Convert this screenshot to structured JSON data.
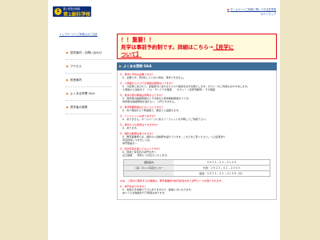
{
  "header": {
    "logo": {
      "sub": "愛と知恵の創造",
      "main": "第1歯科学校",
      "tail": "ホーム",
      "crest": "1"
    },
    "top_link": "ホームページご利用に関しての注意事項",
    "sitemap": "サイトマップ"
  },
  "breadcrumb": "トップページ＞ご利用上のご注意",
  "sidebar": {
    "items": [
      {
        "label": "見学案内・お問い合わせ"
      },
      {
        "label": "アクセス"
      },
      {
        "label": "校舎案内"
      },
      {
        "label": "よくある質問 Q&A"
      },
      {
        "label": "見学者の感想"
      }
    ]
  },
  "banner": {
    "line1": "！！重要！！",
    "line2_text": "見学は事前予約制です。詳細はこちら→",
    "line2_link": "【見学に",
    "line3_link": "ついて】"
  },
  "qa": {
    "heading": "よくある質問 Q&A",
    "items": [
      {
        "q": "Q．見学に予約は必要ですか？",
        "a": [
          "A．必要です。予約をしていない場合、見学できません。"
        ]
      },
      {
        "q": "Q．小雨後からバスでの移動は問題ないですか？",
        "a": [
          "A．今回見に来られて、建築部分に合わせたマスク着用を必ずお願いします。タクシーのご利用もおすすめします。",
          "小雨後から当校まで　バス・８～１０分程度　　タクシー（当家待機車）・８分程度"
        ]
      },
      {
        "q": "Q．見学の受付時間は何時からですか？",
        "a": [
          "A．見学案内開始時間の１５分前から見学開始時間までです。",
          "見学案内開始時間を過ぎると、入門できません。"
        ]
      },
      {
        "q": "Q．見学所要時間はどのくらいですか？",
        "a": [
          "A．約１時間から２時間程で、都合で入館願えます。"
        ]
      },
      {
        "q": "Q．パンフレットはありますか？",
        "a": [
          "A．ありません。ホームページにあるリーフレットを印刷してご利用下さい。"
        ]
      },
      {
        "q": "Q．車椅子でも見学はできますか？",
        "a": [
          "A．あります。"
        ]
      },
      {
        "q": "Q．撮影の制限はありますか？",
        "a": [
          "A．教育事業柄では、撮影の入館制限を設けています。こちらをご覧ください。へ上館見送り",
          "写真資料につきましては、",
          "専門施設の…"
        ]
      },
      {
        "q": "Q．記念写真を撮ってもいいですか？",
        "a": [
          "A．別途ご写真高の専門の方へ",
          "窓口連絡　　特別にてお伝えいたします。"
        ]
      }
    ]
  },
  "contact": {
    "rows": [
      {
        "label": "通院案内",
        "value": "０９２３－４２－５１０９"
      },
      {
        "label": "（専）ポンド写真センター",
        "value": "代表：０９２３－４２－２０６５"
      },
      {
        "label": "",
        "value": "夜間：０９２３－４２－０１９８（代）"
      }
    ]
  },
  "qa2": {
    "items": [
      {
        "q": "なお、ご案内で撮影するか開始は、教育事業所の許可担当以外で専門コースを受けられます。",
        "a": []
      },
      {
        "q": "Q．専門はありますか？",
        "a": [
          "A．本校の日本語クラブにありますので、勉強に力になります。",
          "あいうえお勉強を行う時間はあります。"
        ]
      }
    ]
  }
}
